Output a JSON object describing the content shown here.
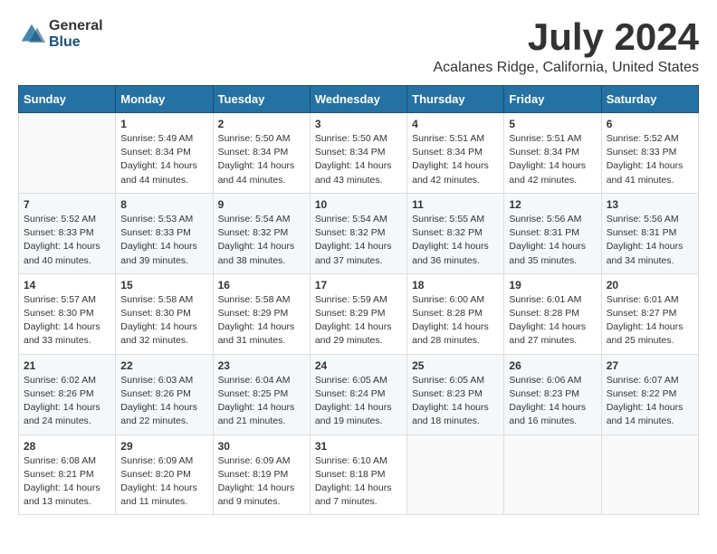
{
  "header": {
    "logo_general": "General",
    "logo_blue": "Blue",
    "month_title": "July 2024",
    "location": "Acalanes Ridge, California, United States"
  },
  "calendar": {
    "days_of_week": [
      "Sunday",
      "Monday",
      "Tuesday",
      "Wednesday",
      "Thursday",
      "Friday",
      "Saturday"
    ],
    "weeks": [
      [
        {
          "day": "",
          "sunrise": "",
          "sunset": "",
          "daylight": ""
        },
        {
          "day": "1",
          "sunrise": "Sunrise: 5:49 AM",
          "sunset": "Sunset: 8:34 PM",
          "daylight": "Daylight: 14 hours and 44 minutes."
        },
        {
          "day": "2",
          "sunrise": "Sunrise: 5:50 AM",
          "sunset": "Sunset: 8:34 PM",
          "daylight": "Daylight: 14 hours and 44 minutes."
        },
        {
          "day": "3",
          "sunrise": "Sunrise: 5:50 AM",
          "sunset": "Sunset: 8:34 PM",
          "daylight": "Daylight: 14 hours and 43 minutes."
        },
        {
          "day": "4",
          "sunrise": "Sunrise: 5:51 AM",
          "sunset": "Sunset: 8:34 PM",
          "daylight": "Daylight: 14 hours and 42 minutes."
        },
        {
          "day": "5",
          "sunrise": "Sunrise: 5:51 AM",
          "sunset": "Sunset: 8:34 PM",
          "daylight": "Daylight: 14 hours and 42 minutes."
        },
        {
          "day": "6",
          "sunrise": "Sunrise: 5:52 AM",
          "sunset": "Sunset: 8:33 PM",
          "daylight": "Daylight: 14 hours and 41 minutes."
        }
      ],
      [
        {
          "day": "7",
          "sunrise": "Sunrise: 5:52 AM",
          "sunset": "Sunset: 8:33 PM",
          "daylight": "Daylight: 14 hours and 40 minutes."
        },
        {
          "day": "8",
          "sunrise": "Sunrise: 5:53 AM",
          "sunset": "Sunset: 8:33 PM",
          "daylight": "Daylight: 14 hours and 39 minutes."
        },
        {
          "day": "9",
          "sunrise": "Sunrise: 5:54 AM",
          "sunset": "Sunset: 8:32 PM",
          "daylight": "Daylight: 14 hours and 38 minutes."
        },
        {
          "day": "10",
          "sunrise": "Sunrise: 5:54 AM",
          "sunset": "Sunset: 8:32 PM",
          "daylight": "Daylight: 14 hours and 37 minutes."
        },
        {
          "day": "11",
          "sunrise": "Sunrise: 5:55 AM",
          "sunset": "Sunset: 8:32 PM",
          "daylight": "Daylight: 14 hours and 36 minutes."
        },
        {
          "day": "12",
          "sunrise": "Sunrise: 5:56 AM",
          "sunset": "Sunset: 8:31 PM",
          "daylight": "Daylight: 14 hours and 35 minutes."
        },
        {
          "day": "13",
          "sunrise": "Sunrise: 5:56 AM",
          "sunset": "Sunset: 8:31 PM",
          "daylight": "Daylight: 14 hours and 34 minutes."
        }
      ],
      [
        {
          "day": "14",
          "sunrise": "Sunrise: 5:57 AM",
          "sunset": "Sunset: 8:30 PM",
          "daylight": "Daylight: 14 hours and 33 minutes."
        },
        {
          "day": "15",
          "sunrise": "Sunrise: 5:58 AM",
          "sunset": "Sunset: 8:30 PM",
          "daylight": "Daylight: 14 hours and 32 minutes."
        },
        {
          "day": "16",
          "sunrise": "Sunrise: 5:58 AM",
          "sunset": "Sunset: 8:29 PM",
          "daylight": "Daylight: 14 hours and 31 minutes."
        },
        {
          "day": "17",
          "sunrise": "Sunrise: 5:59 AM",
          "sunset": "Sunset: 8:29 PM",
          "daylight": "Daylight: 14 hours and 29 minutes."
        },
        {
          "day": "18",
          "sunrise": "Sunrise: 6:00 AM",
          "sunset": "Sunset: 8:28 PM",
          "daylight": "Daylight: 14 hours and 28 minutes."
        },
        {
          "day": "19",
          "sunrise": "Sunrise: 6:01 AM",
          "sunset": "Sunset: 8:28 PM",
          "daylight": "Daylight: 14 hours and 27 minutes."
        },
        {
          "day": "20",
          "sunrise": "Sunrise: 6:01 AM",
          "sunset": "Sunset: 8:27 PM",
          "daylight": "Daylight: 14 hours and 25 minutes."
        }
      ],
      [
        {
          "day": "21",
          "sunrise": "Sunrise: 6:02 AM",
          "sunset": "Sunset: 8:26 PM",
          "daylight": "Daylight: 14 hours and 24 minutes."
        },
        {
          "day": "22",
          "sunrise": "Sunrise: 6:03 AM",
          "sunset": "Sunset: 8:26 PM",
          "daylight": "Daylight: 14 hours and 22 minutes."
        },
        {
          "day": "23",
          "sunrise": "Sunrise: 6:04 AM",
          "sunset": "Sunset: 8:25 PM",
          "daylight": "Daylight: 14 hours and 21 minutes."
        },
        {
          "day": "24",
          "sunrise": "Sunrise: 6:05 AM",
          "sunset": "Sunset: 8:24 PM",
          "daylight": "Daylight: 14 hours and 19 minutes."
        },
        {
          "day": "25",
          "sunrise": "Sunrise: 6:05 AM",
          "sunset": "Sunset: 8:23 PM",
          "daylight": "Daylight: 14 hours and 18 minutes."
        },
        {
          "day": "26",
          "sunrise": "Sunrise: 6:06 AM",
          "sunset": "Sunset: 8:23 PM",
          "daylight": "Daylight: 14 hours and 16 minutes."
        },
        {
          "day": "27",
          "sunrise": "Sunrise: 6:07 AM",
          "sunset": "Sunset: 8:22 PM",
          "daylight": "Daylight: 14 hours and 14 minutes."
        }
      ],
      [
        {
          "day": "28",
          "sunrise": "Sunrise: 6:08 AM",
          "sunset": "Sunset: 8:21 PM",
          "daylight": "Daylight: 14 hours and 13 minutes."
        },
        {
          "day": "29",
          "sunrise": "Sunrise: 6:09 AM",
          "sunset": "Sunset: 8:20 PM",
          "daylight": "Daylight: 14 hours and 11 minutes."
        },
        {
          "day": "30",
          "sunrise": "Sunrise: 6:09 AM",
          "sunset": "Sunset: 8:19 PM",
          "daylight": "Daylight: 14 hours and 9 minutes."
        },
        {
          "day": "31",
          "sunrise": "Sunrise: 6:10 AM",
          "sunset": "Sunset: 8:18 PM",
          "daylight": "Daylight: 14 hours and 7 minutes."
        },
        {
          "day": "",
          "sunrise": "",
          "sunset": "",
          "daylight": ""
        },
        {
          "day": "",
          "sunrise": "",
          "sunset": "",
          "daylight": ""
        },
        {
          "day": "",
          "sunrise": "",
          "sunset": "",
          "daylight": ""
        }
      ]
    ]
  }
}
